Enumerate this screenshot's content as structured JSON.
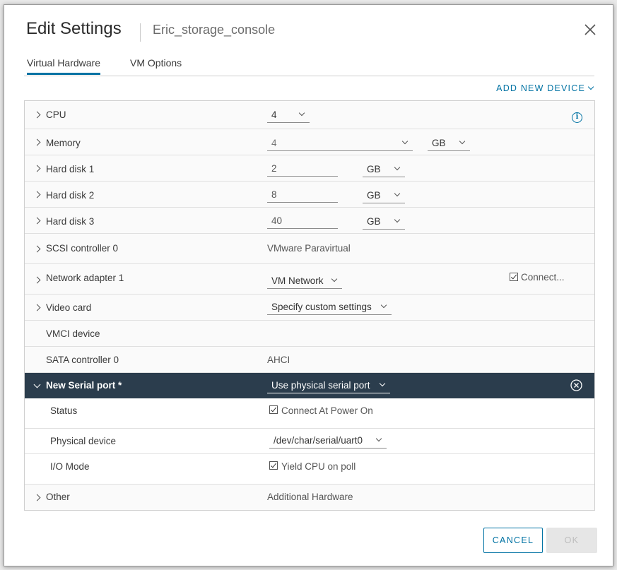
{
  "dialog": {
    "title": "Edit Settings",
    "subtitle": "Eric_storage_console",
    "tabs": [
      "Virtual Hardware",
      "VM Options"
    ],
    "active_tab": "Virtual Hardware",
    "add_device_label": "ADD NEW DEVICE"
  },
  "rows": {
    "cpu": {
      "label": "CPU",
      "value": "4"
    },
    "memory": {
      "label": "Memory",
      "value": "4",
      "unit": "GB"
    },
    "hard_disk_1": {
      "label": "Hard disk 1",
      "value": "2",
      "unit": "GB"
    },
    "hard_disk_2": {
      "label": "Hard disk 2",
      "value": "8",
      "unit": "GB"
    },
    "hard_disk_3": {
      "label": "Hard disk 3",
      "value": "40",
      "unit": "GB"
    },
    "scsi": {
      "label": "SCSI controller 0",
      "value": "VMware Paravirtual"
    },
    "network": {
      "label": "Network adapter 1",
      "value": "VM Network",
      "connect_label": "Connect..."
    },
    "video": {
      "label": "Video card",
      "value": "Specify custom settings"
    },
    "vmci": {
      "label": "VMCI device"
    },
    "sata": {
      "label": "SATA controller 0",
      "value": "AHCI"
    },
    "serial": {
      "label": "New Serial port *",
      "value": "Use physical serial port",
      "status_label": "Status",
      "status_value": "Connect At Power On",
      "physical_label": "Physical device",
      "physical_value": "/dev/char/serial/uart0",
      "io_label": "I/O Mode",
      "io_value": "Yield CPU on poll"
    },
    "other": {
      "label": "Other",
      "value": "Additional Hardware"
    }
  },
  "footer": {
    "cancel_label": "CANCEL",
    "ok_label": "OK"
  },
  "colors": {
    "accent": "#0072a3",
    "selected_row": "#2b3d4d"
  }
}
